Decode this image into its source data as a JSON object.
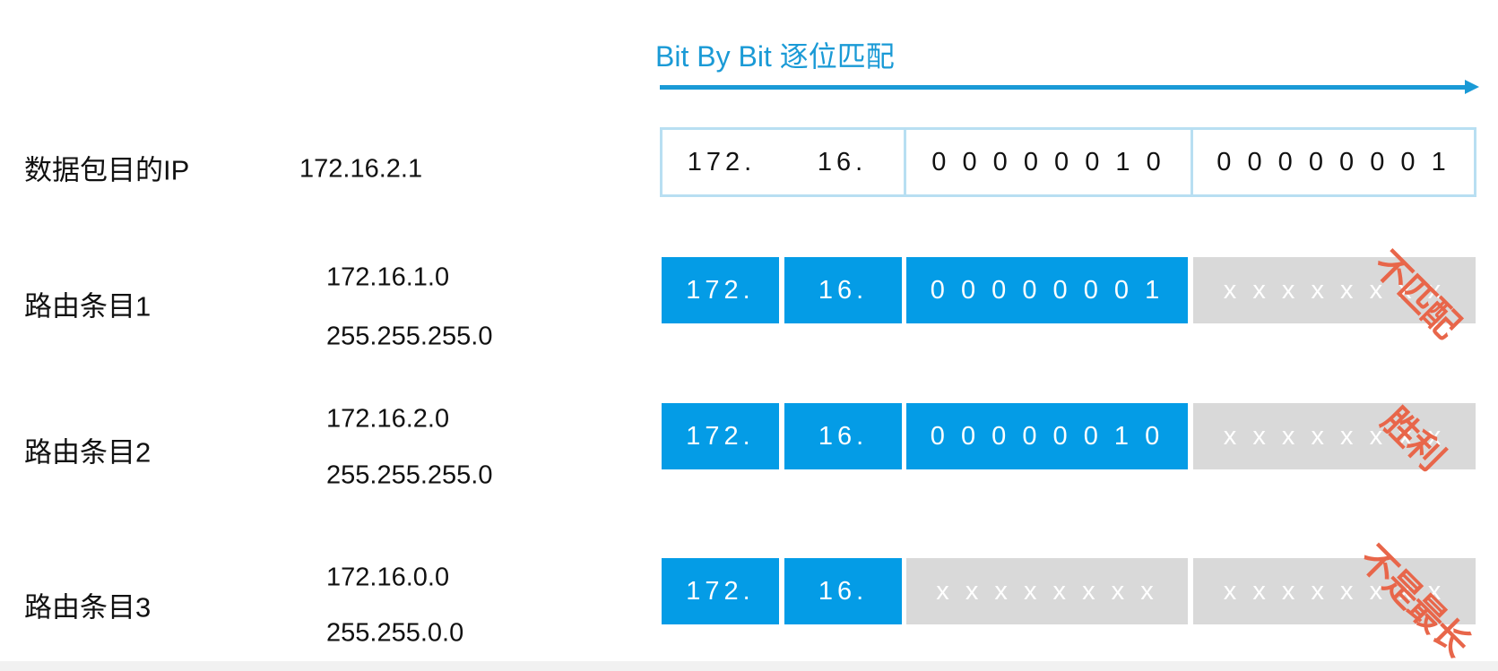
{
  "header": {
    "title": "Bit By Bit 逐位匹配"
  },
  "packet": {
    "label": "数据包目的IP",
    "ip": "172.16.2.1",
    "cells": [
      "172.",
      "16.",
      "0 0 0 0 0 0 1 0",
      "0 0 0 0 0 0 0 1"
    ]
  },
  "routes": [
    {
      "label": "路由条目1",
      "network": "172.16.1.0",
      "mask": "255.255.255.0",
      "cells": [
        "172.",
        "16.",
        "0 0 0 0 0 0 0 1",
        "x x x x x x x x"
      ],
      "stamp": "不匹配"
    },
    {
      "label": "路由条目2",
      "network": "172.16.2.0",
      "mask": "255.255.255.0",
      "cells": [
        "172.",
        "16.",
        "0 0 0 0 0 0 1 0",
        "x x x x x x x x"
      ],
      "stamp": "胜利"
    },
    {
      "label": "路由条目3",
      "network": "172.16.0.0",
      "mask": "255.255.0.0",
      "cells": [
        "172.",
        "16.",
        "x x x x x x x x",
        "x x x x x x x x"
      ],
      "stamp": "不是最长"
    }
  ],
  "colors": {
    "accent": "#1a9ad6",
    "matched": "#049ce6",
    "wildcard": "#d9d9d9",
    "stamp": "#e8664a"
  }
}
